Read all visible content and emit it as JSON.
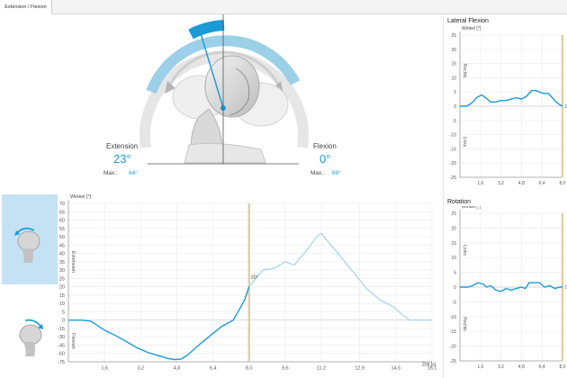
{
  "tabs": [
    {
      "label": "Extension / Flexion"
    }
  ],
  "head": {
    "extension_label": "Extension",
    "extension_value": "23°",
    "extension_max_label": "Max.:",
    "extension_max_value": "64°",
    "flexion_label": "Flexion",
    "flexion_value": "0°",
    "flexion_max_label": "Max.:",
    "flexion_max_value": "69°"
  },
  "modes": [
    {
      "name": "extension-mode-icon",
      "active": true
    },
    {
      "name": "flexion-mode-icon",
      "active": false
    }
  ],
  "colors": {
    "accent": "#1a9bd7",
    "light_accent": "#9ccfe8",
    "marker": "#e0cfa0",
    "active_tile": "#c4e2f4"
  },
  "chart_data": [
    {
      "type": "line",
      "id": "main",
      "title": "",
      "ylabel": "Winkel [°]",
      "xlabel": "Zeit [s]",
      "ylim": [
        -80,
        75
      ],
      "xlim": [
        0,
        16.1
      ],
      "yticks": [
        70,
        65,
        60,
        55,
        50,
        45,
        40,
        35,
        30,
        25,
        20,
        15,
        10,
        5,
        0,
        -15,
        -30,
        -45,
        -60,
        -75
      ],
      "ytick_labels": [
        "70",
        "65",
        "60",
        "55",
        "50",
        "45",
        "40",
        "35",
        "30",
        "25",
        "20",
        "15",
        "10",
        "5",
        "0",
        "-15",
        "-30",
        "-45",
        "-60",
        "-75"
      ],
      "xticks": [
        1.6,
        3.2,
        4.8,
        6.4,
        8.0,
        9.6,
        11.2,
        12.9,
        14.5,
        16.1
      ],
      "xtick_labels": [
        "1,6",
        "3,2",
        "4,8",
        "6,4",
        "8,0",
        "9,6",
        "11,2",
        "12,9",
        "14,5",
        "16,1"
      ],
      "region_labels": {
        "upper": "Extension",
        "lower": "Flexion"
      },
      "marker_x": 8.0,
      "marker_label": "20°",
      "series": [
        {
          "style": "recorded",
          "points": [
            [
              0,
              0
            ],
            [
              0.6,
              0
            ],
            [
              1.0,
              -2
            ],
            [
              1.3,
              -10
            ],
            [
              1.6,
              -18
            ],
            [
              2.0,
              -26
            ],
            [
              2.5,
              -37
            ],
            [
              3.0,
              -49
            ],
            [
              3.5,
              -58
            ],
            [
              4.0,
              -64
            ],
            [
              4.4,
              -69
            ],
            [
              4.7,
              -71
            ],
            [
              5.0,
              -70
            ],
            [
              5.3,
              -62
            ],
            [
              5.8,
              -44
            ],
            [
              6.3,
              -27
            ],
            [
              6.8,
              -11
            ],
            [
              7.3,
              0
            ],
            [
              7.8,
              12
            ],
            [
              8.0,
              20
            ]
          ]
        },
        {
          "style": "reference",
          "points": [
            [
              8.0,
              20
            ],
            [
              8.6,
              30
            ],
            [
              9.1,
              31
            ],
            [
              9.6,
              35
            ],
            [
              10.0,
              33
            ],
            [
              10.5,
              41
            ],
            [
              11.0,
              50
            ],
            [
              11.2,
              52
            ],
            [
              11.5,
              47
            ],
            [
              12.0,
              39
            ],
            [
              12.6,
              29
            ],
            [
              13.2,
              19
            ],
            [
              13.8,
              12
            ],
            [
              14.4,
              8
            ],
            [
              14.8,
              3
            ],
            [
              15.1,
              0
            ],
            [
              16.1,
              0
            ]
          ]
        }
      ]
    },
    {
      "type": "line",
      "id": "lateral",
      "title": "Lateral Flexion",
      "ylabel": "Winkel [°]",
      "ylim": [
        -25,
        25
      ],
      "xlim": [
        0,
        8.0
      ],
      "yticks": [
        25,
        20,
        15,
        10,
        5,
        0,
        -5,
        -10,
        -15,
        -20,
        -25
      ],
      "ytick_labels": [
        "25",
        "20",
        "15",
        "10",
        "5",
        "0",
        "-5",
        "-10",
        "-15",
        "-20",
        "-25"
      ],
      "xticks": [
        1.6,
        3.2,
        4.8,
        6.4,
        8.0
      ],
      "xtick_labels": [
        "1,6",
        "3,2",
        "4,8",
        "6,4",
        "8,0"
      ],
      "region_labels": {
        "upper": "Rechts",
        "lower": "Links"
      },
      "marker_x": 8.0,
      "marker_label": "0",
      "series": [
        {
          "style": "recorded",
          "points": [
            [
              0,
              0
            ],
            [
              0.5,
              0
            ],
            [
              0.9,
              1
            ],
            [
              1.3,
              3
            ],
            [
              1.7,
              4
            ],
            [
              2.0,
              3
            ],
            [
              2.4,
              1.5
            ],
            [
              2.8,
              1.5
            ],
            [
              3.2,
              2
            ],
            [
              3.6,
              2
            ],
            [
              4.0,
              2.5
            ],
            [
              4.4,
              3
            ],
            [
              4.8,
              2.5
            ],
            [
              5.2,
              3.5
            ],
            [
              5.6,
              5.5
            ],
            [
              5.9,
              5.5
            ],
            [
              6.2,
              5
            ],
            [
              6.5,
              4.5
            ],
            [
              6.9,
              4.5
            ],
            [
              7.2,
              3
            ],
            [
              7.5,
              1.5
            ],
            [
              7.8,
              0.5
            ],
            [
              8.0,
              0
            ]
          ]
        }
      ]
    },
    {
      "type": "line",
      "id": "rotation",
      "title": "Rotation",
      "ylabel": "Winkel [°]",
      "ylim": [
        -25,
        25
      ],
      "xlim": [
        0,
        8.0
      ],
      "yticks": [
        25,
        20,
        15,
        10,
        5,
        0,
        -5,
        -10,
        -15,
        -20,
        -25
      ],
      "ytick_labels": [
        "25",
        "20",
        "15",
        "10",
        "5",
        "0",
        "-5",
        "-10",
        "-15",
        "-20",
        "-25"
      ],
      "xticks": [
        1.6,
        3.2,
        4.8,
        6.4,
        8.0
      ],
      "xtick_labels": [
        "1,6",
        "3,2",
        "4,8",
        "6,4",
        "8,0"
      ],
      "region_labels": {
        "upper": "Links",
        "lower": "Rechts"
      },
      "marker_x": 8.0,
      "marker_label": "0",
      "series": [
        {
          "style": "recorded",
          "points": [
            [
              0,
              0
            ],
            [
              0.6,
              0
            ],
            [
              1.0,
              0.5
            ],
            [
              1.4,
              1.5
            ],
            [
              1.8,
              1
            ],
            [
              2.1,
              0
            ],
            [
              2.4,
              0.5
            ],
            [
              2.8,
              -1
            ],
            [
              3.2,
              -1.5
            ],
            [
              3.6,
              -0.5
            ],
            [
              4.0,
              -1
            ],
            [
              4.4,
              -0.5
            ],
            [
              4.8,
              0
            ],
            [
              5.1,
              -0.5
            ],
            [
              5.4,
              1.5
            ],
            [
              5.8,
              1.5
            ],
            [
              6.2,
              1.5
            ],
            [
              6.6,
              0
            ],
            [
              7.0,
              0.5
            ],
            [
              7.4,
              -0.5
            ],
            [
              7.8,
              0
            ],
            [
              8.0,
              0
            ]
          ]
        }
      ]
    }
  ]
}
